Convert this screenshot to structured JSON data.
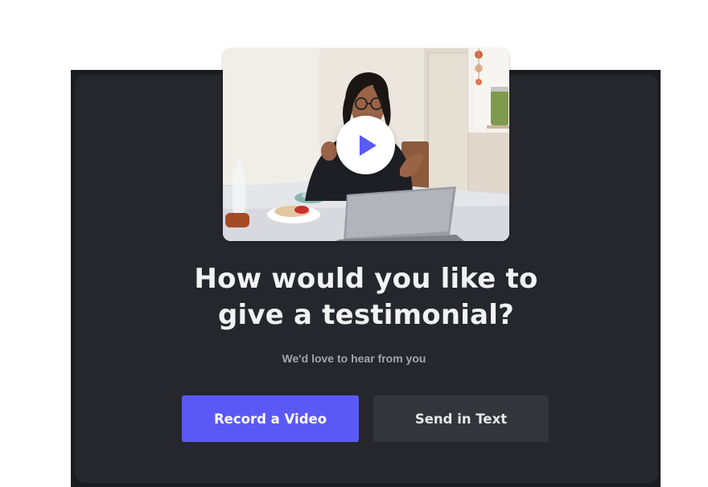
{
  "prompt": {
    "title_line1": "How would you like to",
    "title_line2": "give a testimonial?",
    "subtitle": "We'd love to hear from you"
  },
  "actions": {
    "record_video_label": "Record a Video",
    "send_text_label": "Send in Text"
  },
  "media": {
    "play_icon": "play-icon",
    "thumbnail_subject": "woman at laptop"
  },
  "colors": {
    "accent": "#5b59f6",
    "card_background": "#25272c",
    "secondary_button": "#33353b",
    "title_text": "#f2f2f4",
    "subtitle_text": "#a4a6ad"
  }
}
